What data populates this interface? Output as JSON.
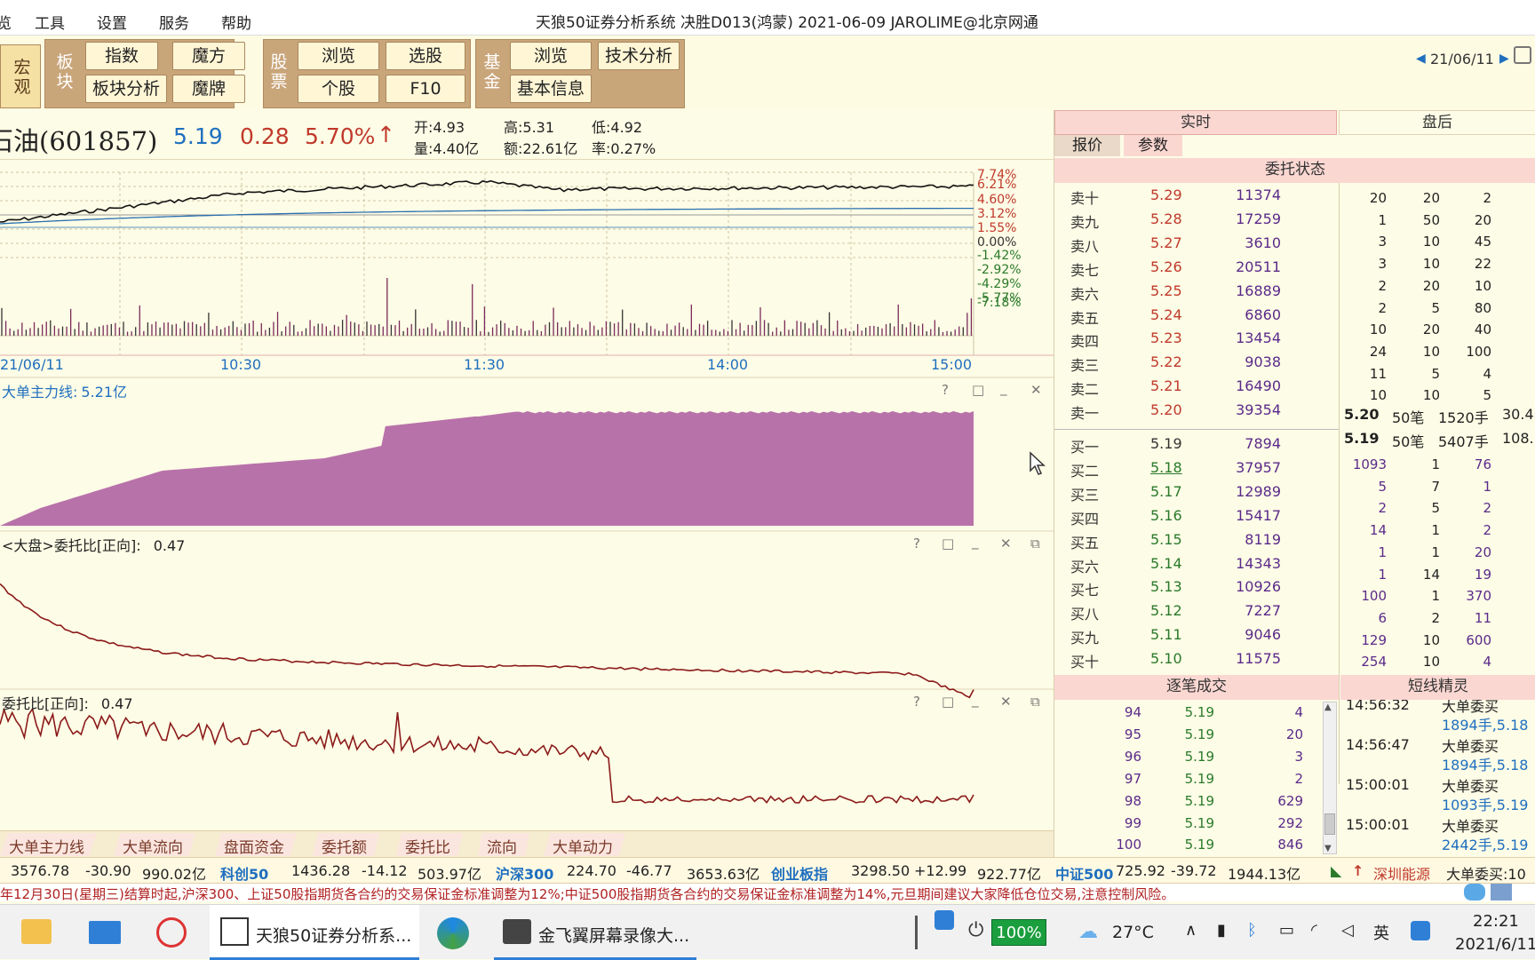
{
  "menubar": {
    "items": [
      "览",
      "工具",
      "设置",
      "服务",
      "帮助"
    ],
    "app_title": "天狼50证券分析系统   决胜D013(鸿蒙)  2021-06-09 JAROLIME@北京网通"
  },
  "toolbar": {
    "macro_label": "宏观",
    "sector_label": "板块",
    "stock_label": "股票",
    "fund_label": "基金",
    "buttons": {
      "index": "指数",
      "mofang": "魔方",
      "sector_analysis": "板块分析",
      "mopai": "魔牌",
      "browse": "浏览",
      "pick": "选股",
      "single": "个股",
      "f10": "F10",
      "fund_browse": "浏览",
      "tech_analysis": "技术分析",
      "basic_info": "基本信息"
    },
    "date_nav": "21/06/11"
  },
  "quote": {
    "name": "石油(601857)",
    "price": "5.19",
    "change": "0.28",
    "pct": "5.70%",
    "arrow": "↑",
    "open": "开:4.93",
    "high": "高:5.31",
    "low": "低:4.92",
    "volume": "量:4.40亿",
    "amount": "额:22.61亿",
    "turnover": "率:0.27%"
  },
  "price_chart": {
    "right_ticks": [
      "7.74%",
      "6.21%",
      "4.60%",
      "3.12%",
      "1.55%",
      "0.00%",
      "-1.42%",
      "-2.92%",
      "-4.29%",
      "-5.77%",
      "-7.18%"
    ],
    "time_ticks": [
      "21/06/11",
      "10:30",
      "11:30",
      "14:00",
      "15:00"
    ]
  },
  "panels": {
    "big_order": {
      "title": "大单主力线:",
      "value": "5.21亿"
    },
    "market_ratio": {
      "title": "<大盘>委托比[正向]:",
      "value": "0.47"
    },
    "stock_ratio": {
      "title": "委托比[正向]:",
      "value": "0.47"
    }
  },
  "bottom_tabs": [
    "大单主力线",
    "大单流向",
    "盘面资金",
    "委托额",
    "委托比",
    "流向",
    "大单动力"
  ],
  "index_bar": [
    {
      "name": "",
      "value": "3576.78",
      "change": "-30.90",
      "amount": "990.02亿"
    },
    {
      "name": "科创50",
      "value": "1436.28",
      "change": "-14.12",
      "amount": "503.97亿"
    },
    {
      "name": "沪深300",
      "value": "224.70",
      "change": "-46.77",
      "amount": "3653.63亿"
    },
    {
      "name": "创业板指",
      "value": "3298.50",
      "change": "+12.99",
      "amount": "922.77亿"
    },
    {
      "name": "中证500",
      "value": "725.92",
      "change": "-39.72",
      "amount": "1944.13亿"
    }
  ],
  "index_tail": {
    "sector": "深圳能源",
    "event": "大单委买:10"
  },
  "notice": "年12月30日(星期三)结算时起,沪深300、上证50股指期货各合约的交易保证金标准调整为12%;中证500股指期货各合约的交易保证金标准调整为14%,元旦期间建议大家降低仓位交易,注意控制风险。",
  "right_panel": {
    "tab_realtime": "实时",
    "tab_after": "盘后",
    "sub_quote": "报价",
    "sub_params": "参数",
    "order_status": "委托状态",
    "sells": [
      {
        "label": "卖十",
        "price": "5.29",
        "vol": "11374"
      },
      {
        "label": "卖九",
        "price": "5.28",
        "vol": "17259"
      },
      {
        "label": "卖八",
        "price": "5.27",
        "vol": "3610"
      },
      {
        "label": "卖七",
        "price": "5.26",
        "vol": "20511"
      },
      {
        "label": "卖六",
        "price": "5.25",
        "vol": "16889"
      },
      {
        "label": "卖五",
        "price": "5.24",
        "vol": "6860"
      },
      {
        "label": "卖四",
        "price": "5.23",
        "vol": "13454"
      },
      {
        "label": "卖三",
        "price": "5.22",
        "vol": "9038"
      },
      {
        "label": "卖二",
        "price": "5.21",
        "vol": "16490"
      },
      {
        "label": "卖一",
        "price": "5.20",
        "vol": "39354"
      }
    ],
    "buys": [
      {
        "label": "买一",
        "price": "5.19",
        "vol": "7894"
      },
      {
        "label": "买二",
        "price": "5.18",
        "vol": "37957"
      },
      {
        "label": "买三",
        "price": "5.17",
        "vol": "12989"
      },
      {
        "label": "买四",
        "price": "5.16",
        "vol": "15417"
      },
      {
        "label": "买五",
        "price": "5.15",
        "vol": "8119"
      },
      {
        "label": "买六",
        "price": "5.14",
        "vol": "14343"
      },
      {
        "label": "买七",
        "price": "5.13",
        "vol": "10926"
      },
      {
        "label": "买八",
        "price": "5.12",
        "vol": "7227"
      },
      {
        "label": "买九",
        "price": "5.11",
        "vol": "9046"
      },
      {
        "label": "买十",
        "price": "5.10",
        "vol": "11575"
      }
    ],
    "sell_queue": [
      [
        "20",
        "20",
        "2"
      ],
      [
        "1",
        "50",
        "20"
      ],
      [
        "3",
        "10",
        "45"
      ],
      [
        "3",
        "10",
        "22"
      ],
      [
        "2",
        "20",
        "10"
      ],
      [
        "2",
        "5",
        "80"
      ],
      [
        "10",
        "20",
        "40"
      ],
      [
        "24",
        "10",
        "100"
      ],
      [
        "11",
        "5",
        "4"
      ],
      [
        "10",
        "10",
        "5"
      ]
    ],
    "ask_summary": {
      "price": "5.20",
      "orders": "50笔",
      "hands": "1520手",
      "extra": "30.4"
    },
    "bid_summary": {
      "price": "5.19",
      "orders": "50笔",
      "hands": "5407手",
      "extra": "108."
    },
    "buy_queue": [
      [
        "1093",
        "1",
        "76"
      ],
      [
        "5",
        "7",
        "1"
      ],
      [
        "2",
        "5",
        "2"
      ],
      [
        "14",
        "1",
        "2"
      ],
      [
        "1",
        "1",
        "20"
      ],
      [
        "1",
        "14",
        "19"
      ],
      [
        "100",
        "1",
        "370"
      ],
      [
        "6",
        "2",
        "11"
      ],
      [
        "129",
        "10",
        "600"
      ],
      [
        "254",
        "10",
        "4"
      ]
    ],
    "ticks_title": "逐笔成交",
    "ticks": [
      {
        "n": "94",
        "p": "5.19",
        "v": "4"
      },
      {
        "n": "95",
        "p": "5.19",
        "v": "20"
      },
      {
        "n": "96",
        "p": "5.19",
        "v": "3"
      },
      {
        "n": "97",
        "p": "5.19",
        "v": "2"
      },
      {
        "n": "98",
        "p": "5.19",
        "v": "629"
      },
      {
        "n": "99",
        "p": "5.19",
        "v": "292"
      },
      {
        "n": "100",
        "p": "5.19",
        "v": "846"
      }
    ],
    "sprite_title": "短线精灵",
    "sprite": [
      {
        "time": "14:56:32",
        "event": "大单委买",
        "detail": "1894手,5.18"
      },
      {
        "time": "14:56:47",
        "event": "大单委买",
        "detail": "1894手,5.18"
      },
      {
        "time": "15:00:01",
        "event": "大单委买",
        "detail": "1093手,5.19"
      },
      {
        "time": "15:00:01",
        "event": "大单委买",
        "detail": "2442手,5.19"
      }
    ]
  },
  "taskbar": {
    "app1": "天狼50证券分析系...",
    "app2": "金飞翼屏幕录像大...",
    "battery": "100%",
    "temp": "27°C",
    "time": "22:21",
    "date": "2021/6/11"
  },
  "colors": {
    "up": "#c0392b",
    "down": "#2a7a2a",
    "blue": "#1f6fbf",
    "purple_fill": "#b872aa",
    "dark_red": "#8b1a1a"
  }
}
